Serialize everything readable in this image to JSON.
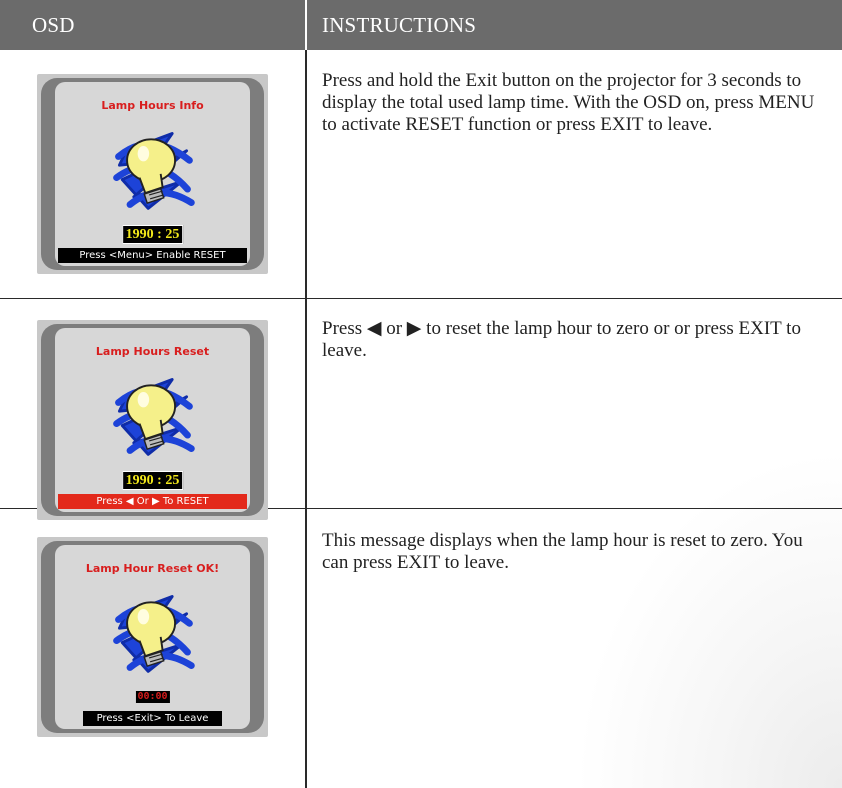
{
  "header": {
    "osd_label": "OSD",
    "instructions_label": "INSTRUCTIONS"
  },
  "rows": [
    {
      "osd": {
        "title": "Lamp Hours Info",
        "time": "1990 : 25",
        "bar": "Press <Menu> Enable RESET",
        "bar_color": "#000000"
      },
      "text": "Press and hold the Exit button on the projector for 3 seconds to display the total used lamp time. With the OSD on, press MENU to activate RESET function or press EXIT to leave."
    },
    {
      "osd": {
        "title": "Lamp Hours Reset",
        "time": "1990 : 25",
        "bar": "Press ◀ Or ▶ To RESET",
        "bar_color": "#e3291b"
      },
      "text": "Press ◀ or ▶ to reset the lamp hour to zero or or press EXIT to leave."
    },
    {
      "osd": {
        "title": "Lamp Hour Reset OK!",
        "time": "00:00",
        "bar": "Press <Exit> To Leave",
        "bar_color": "#000000"
      },
      "text": "This message displays when the lamp hour is reset to zero. You can press EXIT to leave."
    }
  ],
  "icons": {
    "bulb": "lightbulb-icon"
  },
  "colors": {
    "header_bg": "#6b6b6b",
    "osd_title": "#d81e1e",
    "time_text": "#f3e91b",
    "bulb_fill": "#f5f08a",
    "scribble": "#1d43d8"
  }
}
